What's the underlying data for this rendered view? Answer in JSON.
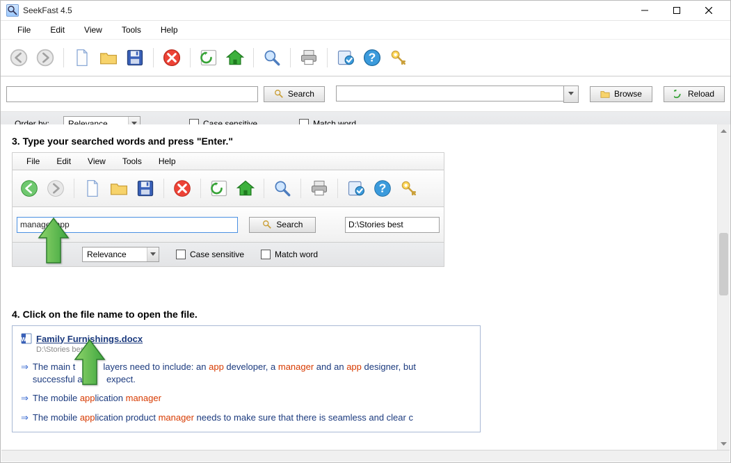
{
  "window": {
    "title": "SeekFast 4.5"
  },
  "menus": {
    "file": "File",
    "edit": "Edit",
    "view": "View",
    "tools": "Tools",
    "help": "Help"
  },
  "toolbar": {
    "back": "back-icon",
    "forward": "forward-icon",
    "new": "new-doc-icon",
    "open": "open-folder-icon",
    "save": "save-icon",
    "close": "close-icon",
    "refresh": "refresh-icon",
    "home": "home-icon",
    "find": "magnifier-icon",
    "print": "printer-icon",
    "check": "checkmark-icon",
    "help": "help-icon",
    "key": "key-icon"
  },
  "searchrow": {
    "input_value": "",
    "search_btn": "Search",
    "path_value": "",
    "browse_btn": "Browse",
    "reload_btn": "Reload"
  },
  "orderrow": {
    "order_by_label": "Order by:",
    "order_by_value": "Relevance",
    "case_sensitive_label": "Case sensitive",
    "match_word_label": "Match word"
  },
  "steps": {
    "step3_heading": "3. Type your searched words and press \"Enter.\"",
    "step4_heading": "4. Click on the file name to open the file."
  },
  "inner": {
    "search_value": "manager app",
    "search_btn": "Search",
    "path_value": "D:\\Stories best",
    "order_by_value": "Relevance",
    "case_sensitive_label": "Case sensitive",
    "match_word_label": "Match word"
  },
  "result": {
    "file_name": "Family Furnishings.docx",
    "file_path": "D:\\Stories best",
    "line1": {
      "a": "The main t",
      "b": "layers need to include: an ",
      "c": "app",
      "d": " developer, a ",
      "e": "manager",
      "f": " and an ",
      "g": "app",
      "h": " designer, but",
      "i": "successful as",
      "j": "expect."
    },
    "line2": {
      "a": "The mobile ",
      "b": "app",
      "c": "lication ",
      "d": "manager"
    },
    "line3": {
      "a": "The mobile ",
      "b": "app",
      "c": "lication product ",
      "d": "manager",
      "e": " needs to make sure that there is seamless and clear c"
    }
  }
}
